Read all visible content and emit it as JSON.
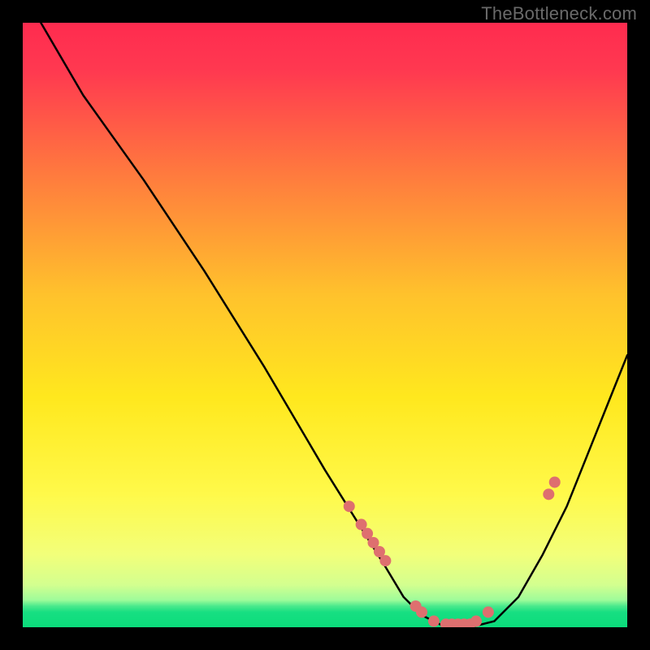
{
  "watermark": "TheBottleneck.com",
  "chart_data": {
    "type": "line",
    "title": "",
    "xlabel": "",
    "ylabel": "",
    "xlim": [
      0,
      100
    ],
    "ylim": [
      0,
      100
    ],
    "grid": false,
    "legend": false,
    "background_gradient": {
      "top_color": "#ff2b4f",
      "mid_color": "#ffe400",
      "bottom_color": "#0bdc7b",
      "bottom_band_start_pct": 95
    },
    "series": [
      {
        "name": "bottleneck-curve",
        "color": "#000000",
        "x": [
          3,
          10,
          20,
          30,
          40,
          50,
          55,
          60,
          63,
          66,
          70,
          74,
          78,
          82,
          86,
          90,
          94,
          98,
          100
        ],
        "values": [
          100,
          88,
          74,
          59,
          43,
          26,
          18,
          10,
          5,
          2,
          0,
          0,
          1,
          5,
          12,
          20,
          30,
          40,
          45
        ]
      }
    ],
    "markers": {
      "name": "highlight-points",
      "color": "#de6f6f",
      "radius_px": 7,
      "x": [
        54,
        56,
        57,
        58,
        59,
        60,
        65,
        66,
        68,
        70,
        71,
        72,
        73,
        74,
        75,
        77,
        87,
        88
      ],
      "values": [
        20,
        17,
        15.5,
        14,
        12.5,
        11,
        3.5,
        2.5,
        1,
        0.5,
        0.5,
        0.5,
        0.5,
        0.5,
        1,
        2.5,
        22,
        24
      ]
    }
  }
}
